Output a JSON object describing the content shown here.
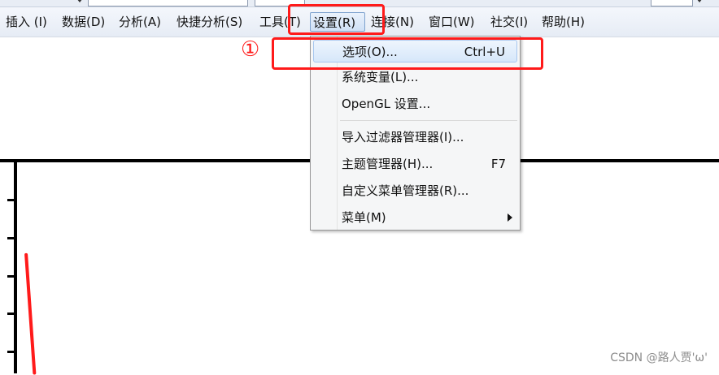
{
  "menubar": {
    "items": [
      {
        "label": "插入 (I)"
      },
      {
        "label": "数据(D)"
      },
      {
        "label": "分析(A)"
      },
      {
        "label": "快捷分析(S)"
      },
      {
        "label": "工具(T)"
      },
      {
        "label": "设置(R)"
      },
      {
        "label": "连接(N)"
      },
      {
        "label": "窗口(W)"
      },
      {
        "label": "社交(I)"
      },
      {
        "label": "帮助(H)"
      }
    ]
  },
  "dropdown": {
    "items": [
      {
        "label": "选项(O)...",
        "shortcut": "Ctrl+U"
      },
      {
        "label": "系统变量(L)...",
        "shortcut": ""
      },
      {
        "label": "OpenGL 设置...",
        "shortcut": ""
      },
      {
        "label": "导入过滤器管理器(I)...",
        "shortcut": ""
      },
      {
        "label": "主题管理器(H)...",
        "shortcut": "F7"
      },
      {
        "label": "自定义菜单管理器(R)...",
        "shortcut": ""
      },
      {
        "label": "菜单(M)",
        "shortcut": ""
      }
    ]
  },
  "annotation": {
    "step_marker": "①",
    "color": "#ff1a1a"
  },
  "watermark": "CSDN @路人贾'ω'"
}
